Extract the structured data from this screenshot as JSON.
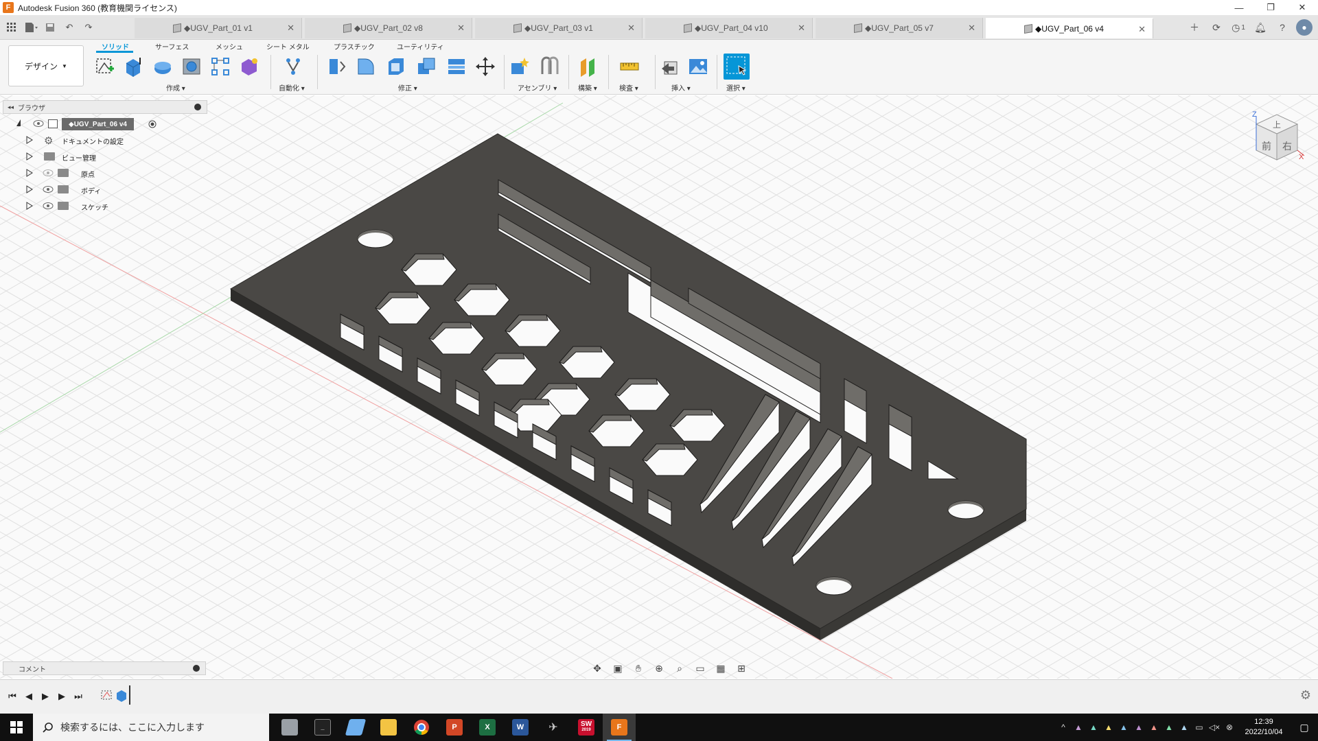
{
  "window": {
    "title": "Autodesk Fusion 360 (教育機関ライセンス)",
    "controls": {
      "minimize": "—",
      "restore": "❐",
      "close": "✕"
    }
  },
  "tabs": [
    {
      "label": "◆UGV_Part_01 v1",
      "active": false
    },
    {
      "label": "◆UGV_Part_02 v8",
      "active": false
    },
    {
      "label": "◆UGV_Part_03 v1",
      "active": false
    },
    {
      "label": "◆UGV_Part_04 v10",
      "active": false
    },
    {
      "label": "◆UGV_Part_05 v7",
      "active": false
    },
    {
      "label": "◆UGV_Part_06 v4",
      "active": true
    }
  ],
  "header_right": {
    "job_count": "1"
  },
  "ribbon": {
    "workspace": "デザイン",
    "tabs": [
      "ソリッド",
      "サーフェス",
      "メッシュ",
      "シート メタル",
      "プラスチック",
      "ユーティリティ"
    ],
    "groups": {
      "create": "作成",
      "automate": "自動化",
      "modify": "修正",
      "assemble": "アセンブリ",
      "construct": "構築",
      "inspect": "検査",
      "insert": "挿入",
      "select": "選択"
    }
  },
  "browser": {
    "title": "ブラウザ",
    "root": "◆UGV_Part_06 v4",
    "items": [
      {
        "label": "ドキュメントの設定",
        "icon": "gear-icon"
      },
      {
        "label": "ビュー管理",
        "icon": "folder-icon"
      },
      {
        "label": "原点",
        "icon": "folder-icon"
      },
      {
        "label": "ボディ",
        "icon": "folder-icon"
      },
      {
        "label": "スケッチ",
        "icon": "folder-icon"
      }
    ]
  },
  "viewcube": {
    "top": "上",
    "front": "前",
    "right": "右",
    "axis_z": "Z",
    "axis_x": "X"
  },
  "comments": {
    "title": "コメント"
  },
  "taskbar": {
    "search_placeholder": "検索するには、ここに入力します",
    "time": "12:39",
    "date": "2022/10/04",
    "apps": [
      "file-explorer-app",
      "terminal-app",
      "notes-app",
      "folder-app",
      "chrome-app",
      "powerpoint-app",
      "excel-app",
      "word-app",
      "game-app",
      "solidworks-app",
      "fusion360-app"
    ],
    "app_labels": {
      "powerpoint": "P",
      "excel": "X",
      "word": "W",
      "solidworks": "SW",
      "solidworks_year": "2019",
      "fusion": "F"
    }
  },
  "colors": {
    "accent": "#0696d7",
    "part_top": "#4a4845",
    "part_side": "#2e2d2b",
    "hole_wall": "#6f6d69",
    "grid": "#dcdcdc",
    "fusion": "#e8761b"
  }
}
